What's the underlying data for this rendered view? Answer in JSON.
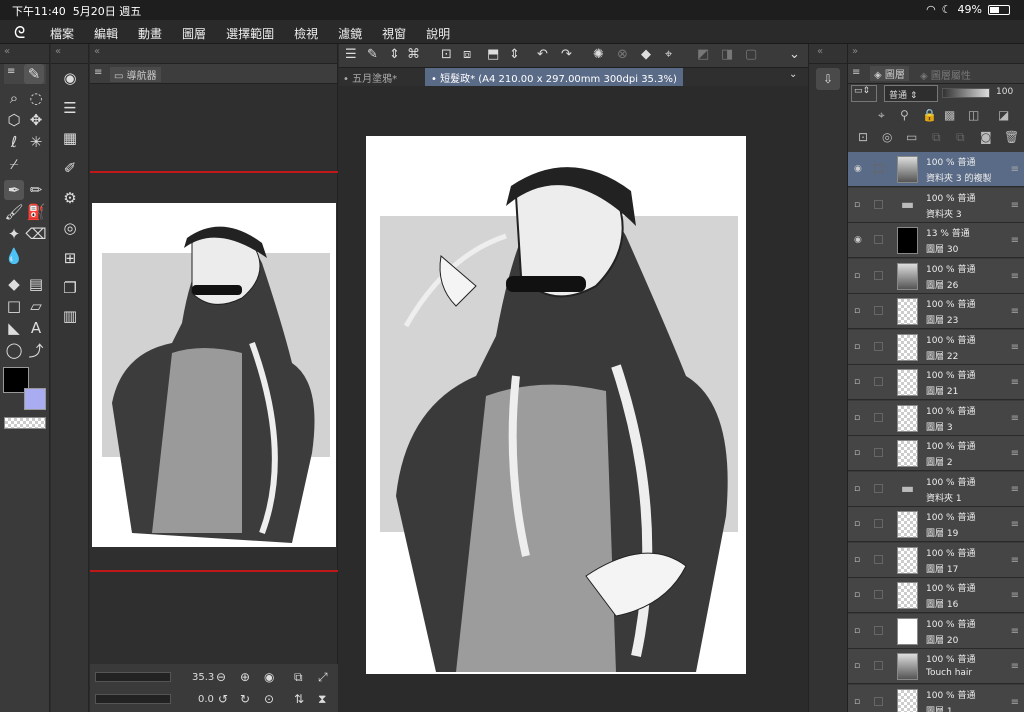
{
  "status": {
    "time": "下午11:40",
    "date": "5月20日 週五",
    "battery": "49%"
  },
  "menu": [
    "檔案",
    "編輯",
    "動畫",
    "圖層",
    "選擇範圍",
    "檢視",
    "濾鏡",
    "視窗",
    "說明"
  ],
  "navigator": {
    "title": "導航器",
    "zoom": "35.3",
    "angle": "0.0"
  },
  "tabs": [
    {
      "label": "五月塗鴉*"
    },
    {
      "label": "短髮政* (A4 210.00 x 297.00mm 300dpi 35.3%)"
    }
  ],
  "layers_panel": {
    "tab_layer": "圖層",
    "tab_prop": "圖層屬性",
    "blend": "普通",
    "opacity": "100"
  },
  "layers": [
    {
      "line1": "100 % 普通",
      "line2": "資料夾 3 的複製",
      "thumb": "art",
      "eye": true,
      "selected": true
    },
    {
      "line1": "100 % 普通",
      "line2": "資料夾 3",
      "thumb": "folder",
      "eye": false
    },
    {
      "line1": "13 % 普通",
      "line2": "圖層 30",
      "thumb": "black",
      "eye": true
    },
    {
      "line1": "100 % 普通",
      "line2": "圖層 26",
      "thumb": "art",
      "eye": false
    },
    {
      "line1": "100 % 普通",
      "line2": "圖層 23",
      "thumb": "check",
      "eye": false
    },
    {
      "line1": "100 % 普通",
      "line2": "圖層 22",
      "thumb": "check",
      "eye": false
    },
    {
      "line1": "100 % 普通",
      "line2": "圖層 21",
      "thumb": "check",
      "eye": false
    },
    {
      "line1": "100 % 普通",
      "line2": "圖層 3",
      "thumb": "check",
      "eye": false
    },
    {
      "line1": "100 % 普通",
      "line2": "圖層 2",
      "thumb": "check",
      "eye": false
    },
    {
      "line1": "100 % 普通",
      "line2": "資料夾 1",
      "thumb": "folder",
      "eye": false
    },
    {
      "line1": "100 % 普通",
      "line2": "圖層 19",
      "thumb": "check",
      "eye": false
    },
    {
      "line1": "100 % 普通",
      "line2": "圖層 17",
      "thumb": "check",
      "eye": false
    },
    {
      "line1": "100 % 普通",
      "line2": "圖層 16",
      "thumb": "check",
      "eye": false
    },
    {
      "line1": "100 % 普通",
      "line2": "圖層 20",
      "thumb": "white",
      "eye": false
    },
    {
      "line1": "100 % 普通",
      "line2": "Touch hair",
      "thumb": "art",
      "eye": false
    },
    {
      "line1": "100 % 普通",
      "line2": "圖層 1",
      "thumb": "check",
      "eye": false
    }
  ]
}
